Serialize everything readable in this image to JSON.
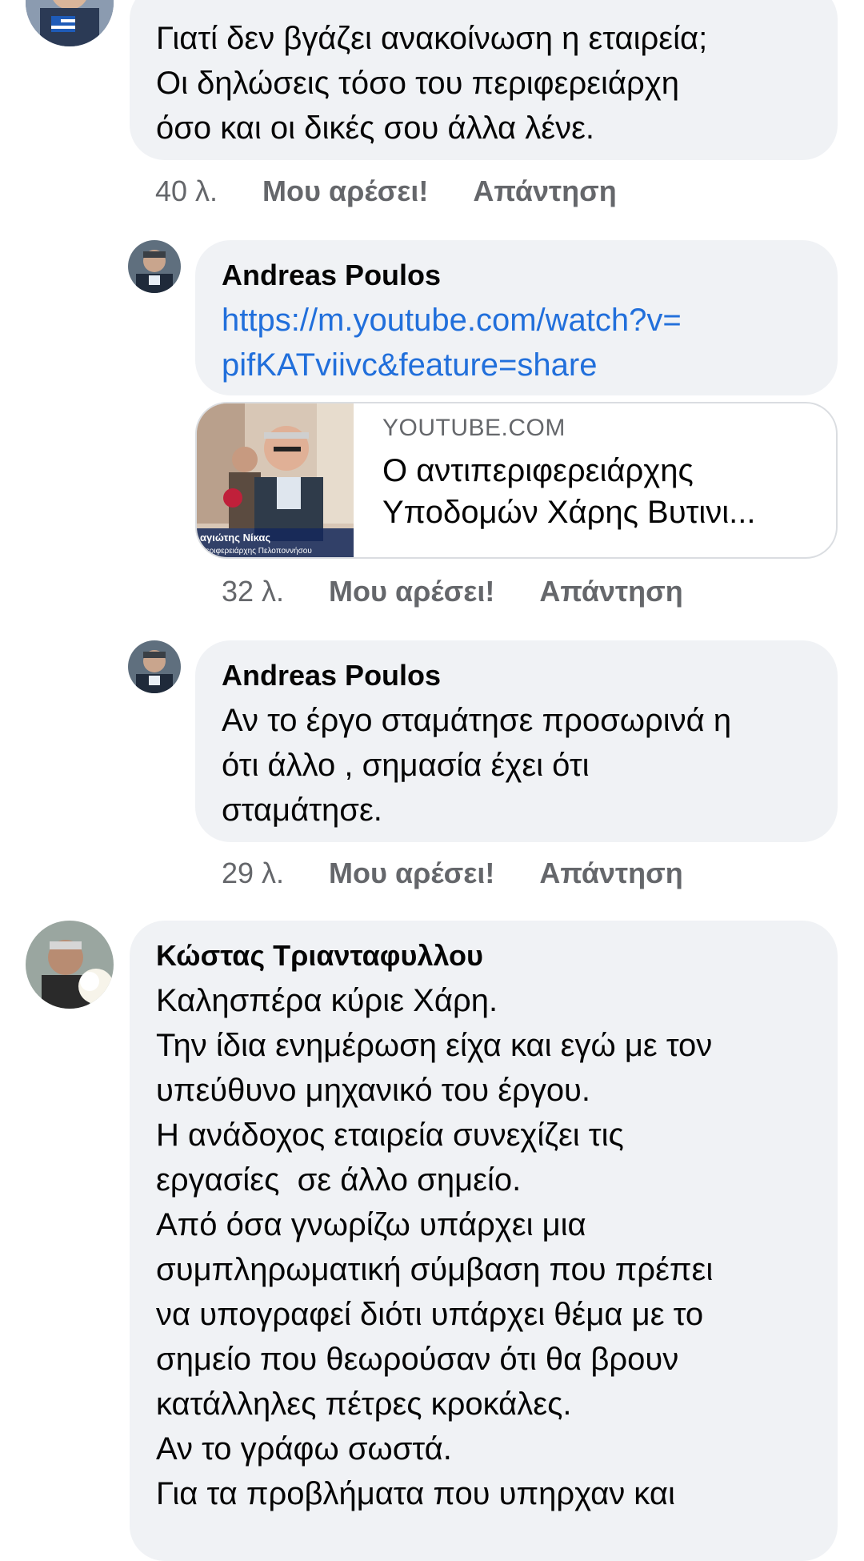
{
  "comments": [
    {
      "text": "Γιατί δεν βγάζει ανακοίνωση η εταιρεία;\nΟι δηλώσεις τόσο του περιφερειάρχη\nόσο και οι δικές σου άλλα λένε.",
      "time": "40 λ.",
      "like": "Μου αρέσει!",
      "reply": "Απάντηση"
    },
    {
      "author": "Andreas Poulos",
      "link": "https://m.youtube.com/watch?v=\npifKATviivc&feature=share",
      "preview": {
        "domain": "YOUTUBE.COM",
        "title": "Ο αντιπεριφερειάρχης\nΥποδομών Χάρης Βυτινι...",
        "caption_name": "αγιώτης Νίκας",
        "caption_role": "Περιφερειάρχης Πελοποννήσου"
      },
      "time": "32 λ.",
      "like": "Μου αρέσει!",
      "reply": "Απάντηση"
    },
    {
      "author": "Andreas Poulos",
      "text": "Αν το έργο σταμάτησε προσωρινά η\nότι άλλο , σημασία έχει ότι\nσταμάτησε.",
      "time": "29 λ.",
      "like": "Μου αρέσει!",
      "reply": "Απάντηση"
    },
    {
      "author": "Κώστας Τριανταφυλλου",
      "text": "Καλησπέρα κύριε Χάρη.\nΤην ίδια ενημέρωση είχα και εγώ με τον\nυπεύθυνο μηχανικό του έργου.\nΗ ανάδοχος εταιρεία συνεχίζει τις\nεργασίες  σε άλλο σημείο.\nΑπό όσα γνωρίζω υπάρχει μια\nσυμπληρωματική σύμβαση που πρέπει\nνα υπογραφεί διότι υπάρχει θέμα με το\nσημείο που θεωρούσαν ότι θα βρουν\nκατάλληλες πέτρες κροκάλες.\nΑν το γράφω σωστά.\nΓια τα προβλήματα που υπηρχαν και"
    }
  ],
  "colors": {
    "bubble": "#f0f2f5",
    "link": "#216fdb",
    "meta": "#65676b"
  }
}
